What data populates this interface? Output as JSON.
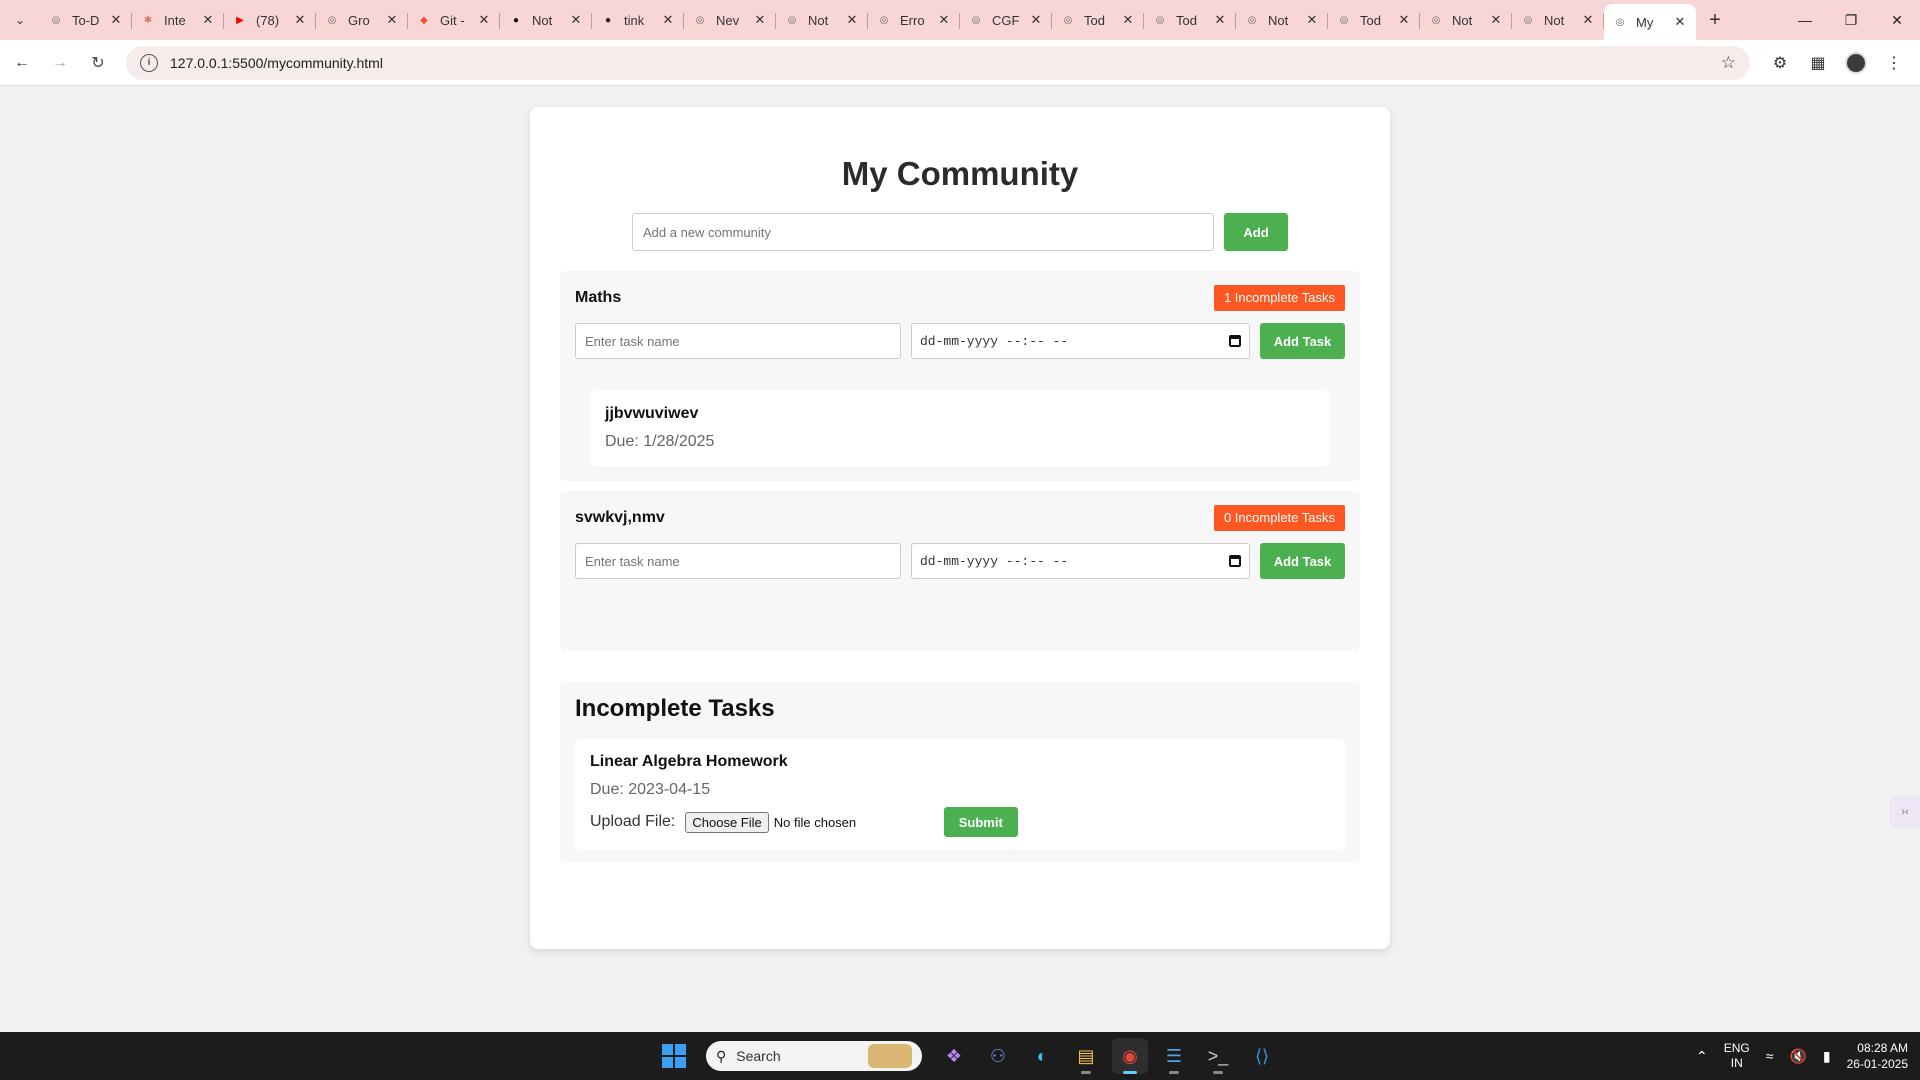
{
  "browser": {
    "tabs": [
      {
        "title": "To-D",
        "icon": "chrome-globe-icon",
        "color": "#5f6368"
      },
      {
        "title": "Inte",
        "icon": "claude-spark-icon",
        "color": "#d97757"
      },
      {
        "title": "(78)",
        "icon": "youtube-icon",
        "color": "#ff0000"
      },
      {
        "title": "Gro",
        "icon": "globe-icon",
        "color": "#5f6368"
      },
      {
        "title": "Git -",
        "icon": "git-icon",
        "color": "#f05032"
      },
      {
        "title": "Not",
        "icon": "github-icon",
        "color": "#111111"
      },
      {
        "title": "tink",
        "icon": "github-icon",
        "color": "#111111"
      },
      {
        "title": "Nev",
        "icon": "globe-icon",
        "color": "#5f6368"
      },
      {
        "title": "Not",
        "icon": "globe-icon",
        "color": "#5f6368"
      },
      {
        "title": "Erro",
        "icon": "globe-icon",
        "color": "#5f6368"
      },
      {
        "title": "CGF",
        "icon": "globe-icon",
        "color": "#5f6368"
      },
      {
        "title": "Tod",
        "icon": "globe-icon",
        "color": "#5f6368"
      },
      {
        "title": "Tod",
        "icon": "globe-icon",
        "color": "#5f6368"
      },
      {
        "title": "Not",
        "icon": "chrome-globe-icon",
        "color": "#5f6368"
      },
      {
        "title": "Tod",
        "icon": "globe-icon",
        "color": "#5f6368"
      },
      {
        "title": "Not",
        "icon": "globe-icon",
        "color": "#5f6368"
      },
      {
        "title": "Not",
        "icon": "globe-icon",
        "color": "#5f6368"
      },
      {
        "title": "My",
        "icon": "globe-icon",
        "color": "#5f6368",
        "active": true
      }
    ],
    "url": "127.0.0.1:5500/mycommunity.html"
  },
  "page": {
    "title": "My Community",
    "add_placeholder": "Add a new community",
    "add_label": "Add",
    "task_placeholder": "Enter task name",
    "date_placeholder": "dd-mm-yyyy --:-- --",
    "add_task_label": "Add Task",
    "communities": [
      {
        "name": "Maths",
        "badge": "1 Incomplete Tasks",
        "tasks": [
          {
            "title": "jjbvwuviwev",
            "due": "Due: 1/28/2025"
          }
        ]
      },
      {
        "name": "svwkvj,nmv",
        "badge": "0 Incomplete Tasks",
        "tasks": []
      }
    ],
    "incomplete": {
      "title": "Incomplete Tasks",
      "tasks": [
        {
          "title": "Linear Algebra Homework",
          "due": "Due: 2023-04-15",
          "upload_label": "Upload File:",
          "choose_label": "Choose File",
          "file_status": "No file chosen",
          "submit_label": "Submit"
        }
      ]
    }
  },
  "colors": {
    "accent_green": "#4caf50",
    "badge_orange": "#ff5722",
    "tabbar_bg": "#f9d6d6"
  },
  "taskbar": {
    "search_label": "Search",
    "apps": [
      "copilot-icon",
      "teams-icon",
      "edge-icon",
      "file-explorer-icon",
      "chrome-icon",
      "notepad-icon",
      "terminal-icon",
      "vscode-icon"
    ],
    "lang_line1": "ENG",
    "lang_line2": "IN",
    "time": "08:28 AM",
    "date": "26-01-2025"
  }
}
